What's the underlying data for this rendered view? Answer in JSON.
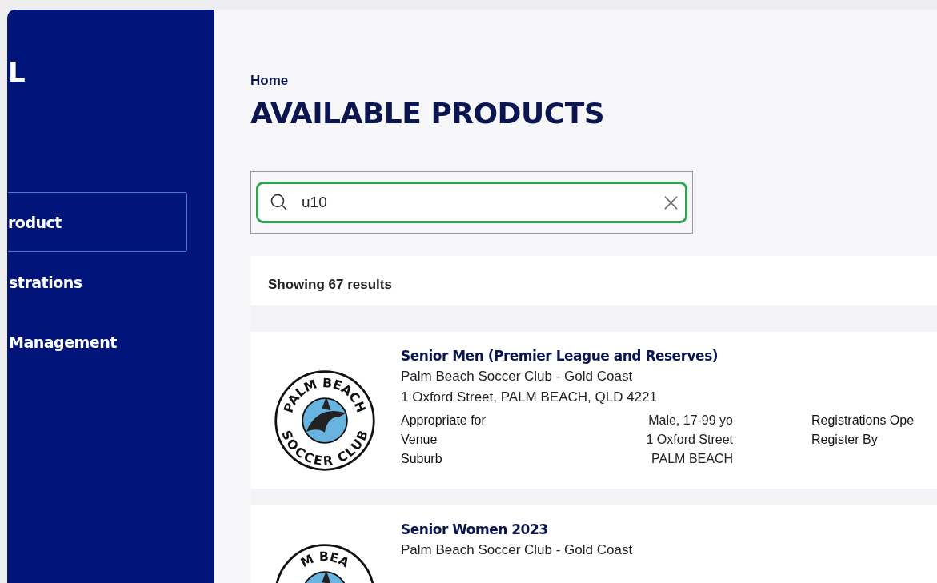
{
  "sidebar": {
    "logo": "L",
    "items": [
      {
        "label": "roduct",
        "selected": true
      },
      {
        "label": "strations",
        "selected": false
      },
      {
        "label": "Management",
        "selected": false
      }
    ]
  },
  "breadcrumb": "Home",
  "title": "AVAILABLE PRODUCTS",
  "search": {
    "value": "u10"
  },
  "results": {
    "count_text": "Showing 67 results",
    "products": [
      {
        "name": "Senior Men (Premier League and Reserves)",
        "club": "Palm Beach Soccer Club - Gold Coast",
        "address": "1 Oxford Street, PALM BEACH, QLD 4221",
        "logo_top": "PALM BEACH",
        "logo_bottom": "SOCCER CLUB",
        "details": [
          {
            "label": "Appropriate for",
            "value": "Male, 17-99 yo"
          },
          {
            "label": "Venue",
            "value": "1 Oxford Street"
          },
          {
            "label": "Suburb",
            "value": "PALM BEACH"
          }
        ],
        "extra": [
          "Registrations Ope",
          "Register By"
        ]
      },
      {
        "name": "Senior Women 2023",
        "club": "Palm Beach Soccer Club - Gold Coast",
        "logo_top": "M BEA"
      }
    ]
  }
}
